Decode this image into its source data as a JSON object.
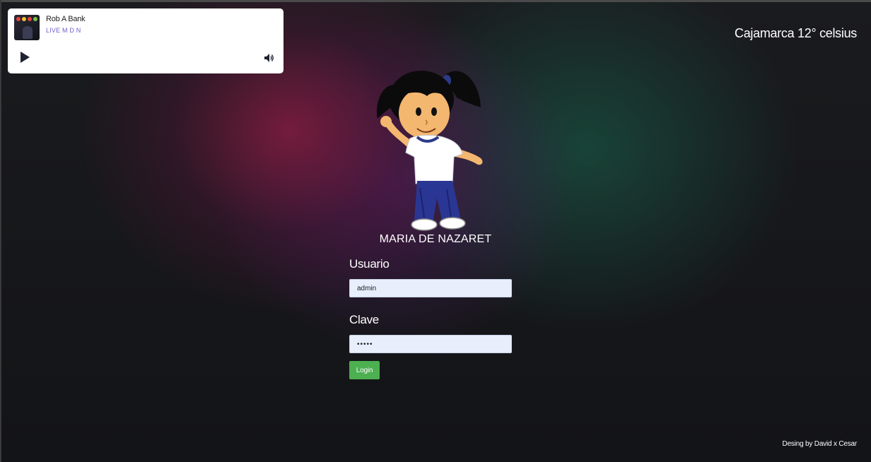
{
  "player": {
    "track_title": "Rob A Bank",
    "track_subtitle": "LIVE M D N",
    "cover_icon": "album-cover-image",
    "play_icon": "play-icon",
    "volume_icon": "volume-icon"
  },
  "weather": {
    "text": "Cajamarca 12° celsius"
  },
  "mascot": {
    "icon": "girl-mascot-illustration"
  },
  "school": {
    "name": "MARIA DE NAZARET"
  },
  "login_form": {
    "username_label": "Usuario",
    "username_value": "admin",
    "password_label": "Clave",
    "password_value": "•••••",
    "login_button": "Login",
    "button_color": "#4caf50",
    "input_background": "#e8eefb"
  },
  "footer": {
    "credit": "Desing by David x Cesar"
  },
  "colors": {
    "background": "#16171a",
    "glow_left": "#821c3e",
    "glow_right": "#185a46",
    "player_subtitle": "#6d5fc9"
  }
}
